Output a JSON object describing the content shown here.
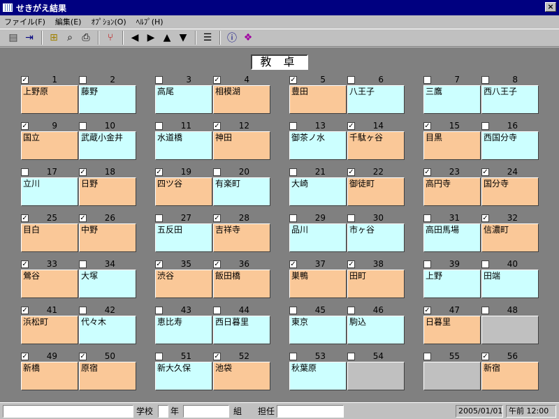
{
  "window": {
    "title": "せきがえ結果",
    "close_glyph": "×"
  },
  "menu": [
    "ファイル(F)",
    "編集(E)",
    "ｵﾌﾟｼｮﾝ(O)",
    "ﾍﾙﾌﾟ(H)"
  ],
  "toolbar_icons": [
    {
      "name": "save-icon",
      "glyph": "▤",
      "color": "#404040"
    },
    {
      "name": "exit-icon",
      "glyph": "⇥",
      "color": "#000080"
    },
    {
      "sep": true
    },
    {
      "name": "open-folder-icon",
      "glyph": "⊞",
      "color": "#a08000"
    },
    {
      "name": "print-preview-icon",
      "glyph": "⌕",
      "color": "#000000"
    },
    {
      "name": "print-icon",
      "glyph": "⎙",
      "color": "#000000"
    },
    {
      "sep": true
    },
    {
      "name": "tree-icon",
      "glyph": "⑂",
      "color": "#c00000"
    },
    {
      "sep": true
    },
    {
      "name": "arrow-left-icon",
      "glyph": "◀",
      "color": "#000000"
    },
    {
      "name": "arrow-right-icon",
      "glyph": "▶",
      "color": "#000000"
    },
    {
      "name": "arrow-up-icon",
      "glyph": "▲",
      "color": "#000000"
    },
    {
      "name": "arrow-down-icon",
      "glyph": "▼",
      "color": "#000000"
    },
    {
      "sep": true
    },
    {
      "name": "properties-icon",
      "glyph": "☰",
      "color": "#000000"
    },
    {
      "sep": true
    },
    {
      "name": "info-icon",
      "glyph": "ⓘ",
      "color": "#000080"
    },
    {
      "name": "help-book-icon",
      "glyph": "❖",
      "color": "#a000a0"
    }
  ],
  "desk_label": "教 卓",
  "colors": {
    "orange": "#fac898",
    "cyan": "#ccffff",
    "gray": "#c0c0c0"
  },
  "seats": [
    {
      "num": "1",
      "name": "上野原",
      "checked": true,
      "color": "orange"
    },
    {
      "num": "2",
      "name": "藤野",
      "checked": false,
      "color": "cyan"
    },
    {
      "num": "3",
      "name": "高尾",
      "checked": false,
      "color": "cyan"
    },
    {
      "num": "4",
      "name": "相模湖",
      "checked": true,
      "color": "orange"
    },
    {
      "num": "5",
      "name": "豊田",
      "checked": true,
      "color": "orange"
    },
    {
      "num": "6",
      "name": "八王子",
      "checked": false,
      "color": "cyan"
    },
    {
      "num": "7",
      "name": "三鷹",
      "checked": false,
      "color": "cyan"
    },
    {
      "num": "8",
      "name": "西八王子",
      "checked": false,
      "color": "cyan"
    },
    {
      "num": "9",
      "name": "国立",
      "checked": true,
      "color": "orange"
    },
    {
      "num": "10",
      "name": "武蔵小金井",
      "checked": false,
      "color": "cyan"
    },
    {
      "num": "11",
      "name": "水道橋",
      "checked": false,
      "color": "cyan"
    },
    {
      "num": "12",
      "name": "神田",
      "checked": true,
      "color": "orange"
    },
    {
      "num": "13",
      "name": "御茶ノ水",
      "checked": false,
      "color": "cyan"
    },
    {
      "num": "14",
      "name": "千駄ヶ谷",
      "checked": true,
      "color": "orange"
    },
    {
      "num": "15",
      "name": "目黒",
      "checked": true,
      "color": "orange"
    },
    {
      "num": "16",
      "name": "西国分寺",
      "checked": false,
      "color": "cyan"
    },
    {
      "num": "17",
      "name": "立川",
      "checked": false,
      "color": "cyan"
    },
    {
      "num": "18",
      "name": "日野",
      "checked": true,
      "color": "orange"
    },
    {
      "num": "19",
      "name": "四ツ谷",
      "checked": true,
      "color": "orange"
    },
    {
      "num": "20",
      "name": "有楽町",
      "checked": false,
      "color": "cyan"
    },
    {
      "num": "21",
      "name": "大崎",
      "checked": false,
      "color": "cyan"
    },
    {
      "num": "22",
      "name": "御徒町",
      "checked": true,
      "color": "orange"
    },
    {
      "num": "23",
      "name": "高円寺",
      "checked": true,
      "color": "orange"
    },
    {
      "num": "24",
      "name": "国分寺",
      "checked": true,
      "color": "orange"
    },
    {
      "num": "25",
      "name": "目白",
      "checked": true,
      "color": "orange"
    },
    {
      "num": "26",
      "name": "中野",
      "checked": true,
      "color": "orange"
    },
    {
      "num": "27",
      "name": "五反田",
      "checked": false,
      "color": "cyan"
    },
    {
      "num": "28",
      "name": "吉祥寺",
      "checked": true,
      "color": "orange"
    },
    {
      "num": "29",
      "name": "品川",
      "checked": false,
      "color": "cyan"
    },
    {
      "num": "30",
      "name": "市ヶ谷",
      "checked": false,
      "color": "cyan"
    },
    {
      "num": "31",
      "name": "高田馬場",
      "checked": false,
      "color": "cyan"
    },
    {
      "num": "32",
      "name": "信濃町",
      "checked": true,
      "color": "orange"
    },
    {
      "num": "33",
      "name": "鶯谷",
      "checked": true,
      "color": "orange"
    },
    {
      "num": "34",
      "name": "大塚",
      "checked": false,
      "color": "cyan"
    },
    {
      "num": "35",
      "name": "渋谷",
      "checked": true,
      "color": "orange"
    },
    {
      "num": "36",
      "name": "飯田橋",
      "checked": true,
      "color": "orange"
    },
    {
      "num": "37",
      "name": "巣鴨",
      "checked": true,
      "color": "orange"
    },
    {
      "num": "38",
      "name": "田町",
      "checked": true,
      "color": "orange"
    },
    {
      "num": "39",
      "name": "上野",
      "checked": false,
      "color": "cyan"
    },
    {
      "num": "40",
      "name": "田端",
      "checked": false,
      "color": "cyan"
    },
    {
      "num": "41",
      "name": "浜松町",
      "checked": true,
      "color": "orange"
    },
    {
      "num": "42",
      "name": "代々木",
      "checked": false,
      "color": "cyan"
    },
    {
      "num": "43",
      "name": "恵比寿",
      "checked": false,
      "color": "cyan"
    },
    {
      "num": "44",
      "name": "西日暮里",
      "checked": false,
      "color": "cyan"
    },
    {
      "num": "45",
      "name": "東京",
      "checked": false,
      "color": "cyan"
    },
    {
      "num": "46",
      "name": "駒込",
      "checked": false,
      "color": "cyan"
    },
    {
      "num": "47",
      "name": "日暮里",
      "checked": true,
      "color": "orange"
    },
    {
      "num": "48",
      "name": "",
      "checked": false,
      "color": "gray"
    },
    {
      "num": "49",
      "name": "新橋",
      "checked": true,
      "color": "orange"
    },
    {
      "num": "50",
      "name": "原宿",
      "checked": true,
      "color": "orange"
    },
    {
      "num": "51",
      "name": "新大久保",
      "checked": false,
      "color": "cyan"
    },
    {
      "num": "52",
      "name": "池袋",
      "checked": true,
      "color": "orange"
    },
    {
      "num": "53",
      "name": "秋葉原",
      "checked": false,
      "color": "cyan"
    },
    {
      "num": "54",
      "name": "",
      "checked": false,
      "color": "gray"
    },
    {
      "num": "55",
      "name": "",
      "checked": false,
      "color": "gray"
    },
    {
      "num": "56",
      "name": "新宿",
      "checked": true,
      "color": "orange"
    }
  ],
  "status": {
    "field1": "",
    "school_label": "学校",
    "field2": "",
    "year_label": "年",
    "field3": "",
    "class_label": "組",
    "teacher_label": "担任",
    "field4": "",
    "date": "2005/01/01",
    "time": "午前 12:00"
  }
}
